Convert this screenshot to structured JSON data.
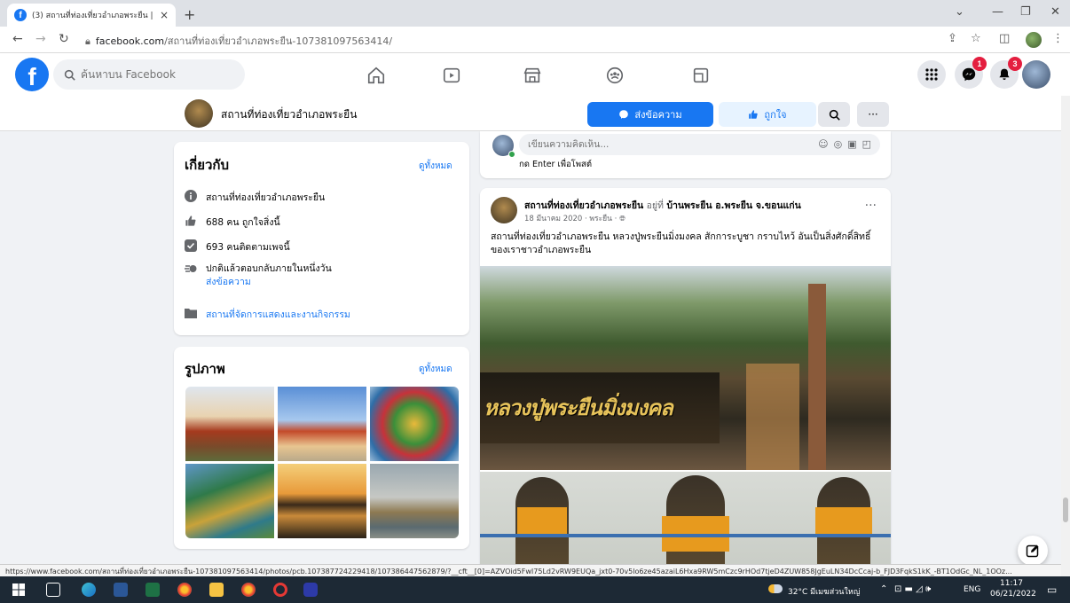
{
  "browser": {
    "tab_title": "(3) สถานที่ท่องเที่ยวอำเภอพระยืน | Fa",
    "tab_close": "×",
    "new_tab": "+",
    "url_domain": "facebook.com",
    "url_path": "/สถานที่ท่องเที่ยวอำเภอพระยืน-107381097563414/"
  },
  "fbnav": {
    "search_placeholder": "ค้นหาบน Facebook",
    "messenger_badge": "1",
    "notifications_badge": "3"
  },
  "page_header": {
    "name": "สถานที่ท่องเที่ยวอำเภอพระยืน",
    "message_button": "ส่งข้อความ",
    "like_button": "ถูกใจ",
    "more": "···"
  },
  "about": {
    "title": "เกี่ยวกับ",
    "see_all": "ดูทั้งหมด",
    "description": "สถานที่ท่องเที่ยวอำเภอพระยืน",
    "likes": "688 คน ถูกใจสิ่งนี้",
    "follows": "693 คนติดตามเพจนี้",
    "response": "ปกติแล้วตอบกลับภายในหนึ่งวัน",
    "send_message": "ส่งข้อความ",
    "category": "สถานที่จัดการแสดงและงานกิจกรรม"
  },
  "photos": {
    "title": "รูปภาพ",
    "see_all": "ดูทั้งหมด"
  },
  "composer": {
    "placeholder": "เขียนความคิดเห็น...",
    "hint": "กด Enter เพื่อโพสต์"
  },
  "post": {
    "author": "สถานที่ท่องเที่ยวอำเภอพระยืน",
    "at": "อยู่ที่",
    "location": "บ้านพระยืน อ.พระยืน จ.ขอนแก่น",
    "meta": "18 มีนาคม 2020 · พระยืน · ",
    "more": "···",
    "text": "สถานที่ท่องเที่ยวอำเภอพระยืน หลวงปู่พระยืนมิ่งมงคล สักการะบูชา กราบไหว้ อันเป็นสิ่งศักดิ์สิทธิ์ของเราชาวอำเภอพระยืน",
    "sign_text": "หลวงปู่พระยืนมิ่งมงคล"
  },
  "status_url": "https://www.facebook.com/สถานที่ท่องเที่ยวอำเภอพระยืน-107381097563414/photos/pcb.107387724229418/107386447562879/?__cft__[0]=AZVOid5FwI75Ld2vRW9EUQa_jxt0-70v5lo6ze45azaiL6Hxa9RW5mCzc9rHOd7tjeD4ZUW858JgEuLN34DcCcaj-b_FJD3FqkS1kK_-BT1OdGc_NL_1OOz...",
  "taskbar": {
    "weather": "32°C มีเมฆส่วนใหญ่",
    "lang": "ENG",
    "time": "11:17",
    "date": "06/21/2022"
  },
  "colors": {
    "fb_blue": "#1877f2",
    "badge_red": "#e41e3f",
    "taskbar": "#1d2935"
  }
}
